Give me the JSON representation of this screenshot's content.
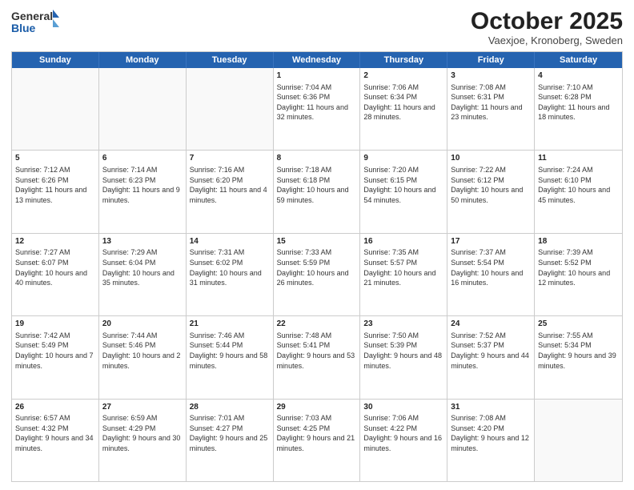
{
  "logo": {
    "general": "General",
    "blue": "Blue"
  },
  "header": {
    "month": "October 2025",
    "location": "Vaexjoe, Kronoberg, Sweden"
  },
  "weekdays": [
    "Sunday",
    "Monday",
    "Tuesday",
    "Wednesday",
    "Thursday",
    "Friday",
    "Saturday"
  ],
  "weeks": [
    [
      {
        "day": "",
        "info": "",
        "empty": true
      },
      {
        "day": "",
        "info": "",
        "empty": true
      },
      {
        "day": "",
        "info": "",
        "empty": true
      },
      {
        "day": "1",
        "info": "Sunrise: 7:04 AM\nSunset: 6:36 PM\nDaylight: 11 hours and 32 minutes."
      },
      {
        "day": "2",
        "info": "Sunrise: 7:06 AM\nSunset: 6:34 PM\nDaylight: 11 hours and 28 minutes."
      },
      {
        "day": "3",
        "info": "Sunrise: 7:08 AM\nSunset: 6:31 PM\nDaylight: 11 hours and 23 minutes."
      },
      {
        "day": "4",
        "info": "Sunrise: 7:10 AM\nSunset: 6:28 PM\nDaylight: 11 hours and 18 minutes."
      }
    ],
    [
      {
        "day": "5",
        "info": "Sunrise: 7:12 AM\nSunset: 6:26 PM\nDaylight: 11 hours and 13 minutes."
      },
      {
        "day": "6",
        "info": "Sunrise: 7:14 AM\nSunset: 6:23 PM\nDaylight: 11 hours and 9 minutes."
      },
      {
        "day": "7",
        "info": "Sunrise: 7:16 AM\nSunset: 6:20 PM\nDaylight: 11 hours and 4 minutes."
      },
      {
        "day": "8",
        "info": "Sunrise: 7:18 AM\nSunset: 6:18 PM\nDaylight: 10 hours and 59 minutes."
      },
      {
        "day": "9",
        "info": "Sunrise: 7:20 AM\nSunset: 6:15 PM\nDaylight: 10 hours and 54 minutes."
      },
      {
        "day": "10",
        "info": "Sunrise: 7:22 AM\nSunset: 6:12 PM\nDaylight: 10 hours and 50 minutes."
      },
      {
        "day": "11",
        "info": "Sunrise: 7:24 AM\nSunset: 6:10 PM\nDaylight: 10 hours and 45 minutes."
      }
    ],
    [
      {
        "day": "12",
        "info": "Sunrise: 7:27 AM\nSunset: 6:07 PM\nDaylight: 10 hours and 40 minutes."
      },
      {
        "day": "13",
        "info": "Sunrise: 7:29 AM\nSunset: 6:04 PM\nDaylight: 10 hours and 35 minutes."
      },
      {
        "day": "14",
        "info": "Sunrise: 7:31 AM\nSunset: 6:02 PM\nDaylight: 10 hours and 31 minutes."
      },
      {
        "day": "15",
        "info": "Sunrise: 7:33 AM\nSunset: 5:59 PM\nDaylight: 10 hours and 26 minutes."
      },
      {
        "day": "16",
        "info": "Sunrise: 7:35 AM\nSunset: 5:57 PM\nDaylight: 10 hours and 21 minutes."
      },
      {
        "day": "17",
        "info": "Sunrise: 7:37 AM\nSunset: 5:54 PM\nDaylight: 10 hours and 16 minutes."
      },
      {
        "day": "18",
        "info": "Sunrise: 7:39 AM\nSunset: 5:52 PM\nDaylight: 10 hours and 12 minutes."
      }
    ],
    [
      {
        "day": "19",
        "info": "Sunrise: 7:42 AM\nSunset: 5:49 PM\nDaylight: 10 hours and 7 minutes."
      },
      {
        "day": "20",
        "info": "Sunrise: 7:44 AM\nSunset: 5:46 PM\nDaylight: 10 hours and 2 minutes."
      },
      {
        "day": "21",
        "info": "Sunrise: 7:46 AM\nSunset: 5:44 PM\nDaylight: 9 hours and 58 minutes."
      },
      {
        "day": "22",
        "info": "Sunrise: 7:48 AM\nSunset: 5:41 PM\nDaylight: 9 hours and 53 minutes."
      },
      {
        "day": "23",
        "info": "Sunrise: 7:50 AM\nSunset: 5:39 PM\nDaylight: 9 hours and 48 minutes."
      },
      {
        "day": "24",
        "info": "Sunrise: 7:52 AM\nSunset: 5:37 PM\nDaylight: 9 hours and 44 minutes."
      },
      {
        "day": "25",
        "info": "Sunrise: 7:55 AM\nSunset: 5:34 PM\nDaylight: 9 hours and 39 minutes."
      }
    ],
    [
      {
        "day": "26",
        "info": "Sunrise: 6:57 AM\nSunset: 4:32 PM\nDaylight: 9 hours and 34 minutes."
      },
      {
        "day": "27",
        "info": "Sunrise: 6:59 AM\nSunset: 4:29 PM\nDaylight: 9 hours and 30 minutes."
      },
      {
        "day": "28",
        "info": "Sunrise: 7:01 AM\nSunset: 4:27 PM\nDaylight: 9 hours and 25 minutes."
      },
      {
        "day": "29",
        "info": "Sunrise: 7:03 AM\nSunset: 4:25 PM\nDaylight: 9 hours and 21 minutes."
      },
      {
        "day": "30",
        "info": "Sunrise: 7:06 AM\nSunset: 4:22 PM\nDaylight: 9 hours and 16 minutes."
      },
      {
        "day": "31",
        "info": "Sunrise: 7:08 AM\nSunset: 4:20 PM\nDaylight: 9 hours and 12 minutes."
      },
      {
        "day": "",
        "info": "",
        "empty": true
      }
    ]
  ]
}
